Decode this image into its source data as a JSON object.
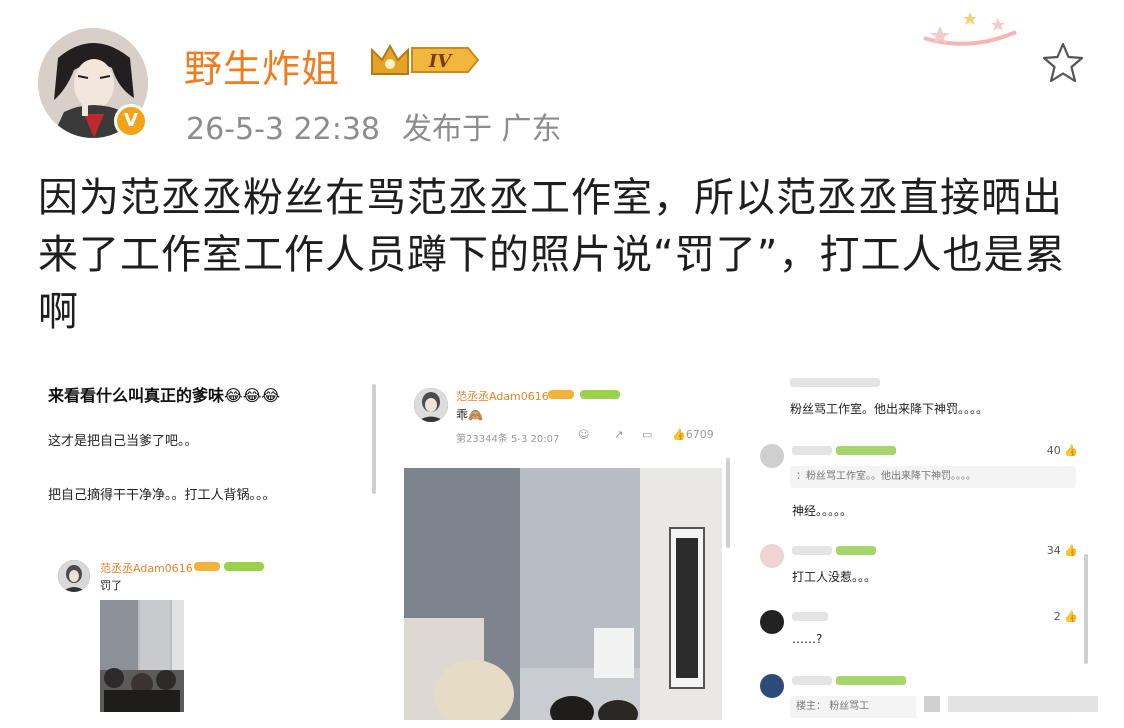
{
  "post": {
    "author": "野生炸姐",
    "level_badge": "IV",
    "verified_badge": "V",
    "date": "26-5-3 22:38",
    "location": "发布于 广东",
    "text": "因为范丞丞粉丝在骂范丞丞工作室，所以范丞丞直接晒出来了工作室工作人员蹲下的照片说“罚了”，打工人也是累啊"
  },
  "colors": {
    "author": "#f07c1e",
    "meta": "#8d8d8d",
    "verified": "#f3a317"
  },
  "icons": {
    "favorite": "star-outline-icon"
  },
  "panel1": {
    "title": "来看看什么叫真正的爹味😂😂😂",
    "line1": "这才是把自己当爹了吧。。",
    "line2": "把自己摘得干干净净。。打工人背锅。。。",
    "embed": {
      "name": "范丞丞Adam0616",
      "text": "罚了"
    }
  },
  "panel2": {
    "name": "范丞丞Adam0616",
    "text": "乖🙈",
    "meta": "第23344条 5-3 20:07",
    "likes": "6709"
  },
  "panel3": {
    "top_text": "粉丝骂工作室。他出来降下神罚。。。。",
    "comments": [
      {
        "likes": "40",
        "quote": "：粉丝骂工作室。。他出来降下神罚。。。。",
        "text": "神经。。。。。"
      },
      {
        "likes": "34",
        "text": "打工人没惹。。。"
      },
      {
        "likes": "2",
        "text": "……?"
      },
      {
        "role": "楼主：",
        "quote": "粉丝骂工"
      }
    ]
  }
}
